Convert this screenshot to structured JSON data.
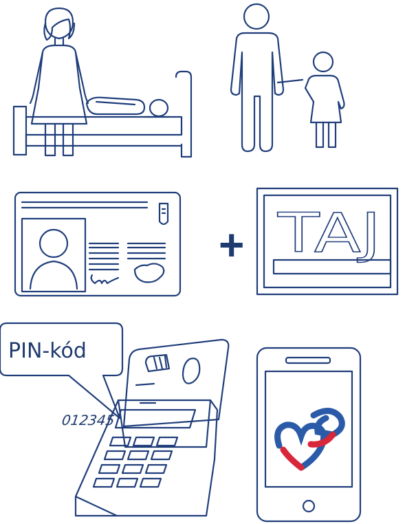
{
  "colors": {
    "stroke": "#1f3d7a",
    "plus": "#1f3a6e",
    "logo_blue": "#2a5aa8",
    "logo_red": "#d8273b",
    "background": "#ffffff"
  },
  "icons": [
    "woman-caregiver-icon",
    "hospital-bed-patient-icon",
    "father-with-child-icon",
    "id-card-icon",
    "plus-icon",
    "taj-card-icon",
    "card-reader-icon",
    "smartphone-icon",
    "eeszt-logo-icon"
  ],
  "taj_card": {
    "label": "TAJ"
  },
  "plus_sign": {
    "symbol": "+"
  },
  "card_reader": {
    "speech_bubble_text": "PIN-kód",
    "display_code": "012345"
  }
}
